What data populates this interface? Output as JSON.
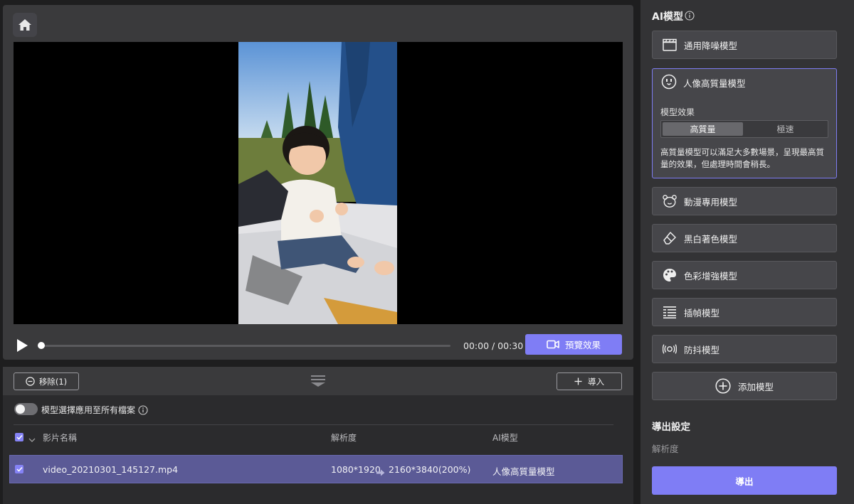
{
  "preview": {
    "time": "00:00 / 00:30",
    "preview_label": "預覽效果",
    "progress": 0
  },
  "files": {
    "remove_label": "移除(1)",
    "import_label": "導入",
    "apply_all_label": "模型選擇應用至所有檔案",
    "apply_all_on": false,
    "columns": {
      "name": "影片名稱",
      "resolution": "解析度",
      "model": "AI模型"
    },
    "rows": [
      {
        "name": "video_20210301_145127.mp4",
        "resolution_from": "1080*1920",
        "resolution_to": "2160*3840(200%)",
        "model": "人像高質量模型",
        "checked": true
      }
    ]
  },
  "models": {
    "title": "AI模型",
    "items": [
      {
        "label": "通用降噪模型",
        "icon": "clapperboard-icon"
      },
      {
        "label": "人像高質量模型",
        "icon": "face-icon",
        "selected": true
      },
      {
        "label": "動漫專用模型",
        "icon": "bear-icon"
      },
      {
        "label": "黑白著色模型",
        "icon": "eraser-icon"
      },
      {
        "label": "色彩增強模型",
        "icon": "palette-icon"
      },
      {
        "label": "插幀模型",
        "icon": "frames-icon"
      },
      {
        "label": "防抖模型",
        "icon": "stabilize-icon"
      }
    ],
    "effect_label": "模型效果",
    "effect_options": [
      "高質量",
      "極速"
    ],
    "effect_selected": "高質量",
    "description": "高質量模型可以滿足大多數場景，呈現最高質量的效果，但處理時間會稍長。",
    "add_label": "添加模型"
  },
  "export": {
    "title": "導出設定",
    "resolution_label": "解析度",
    "export_label": "導出"
  },
  "colors": {
    "accent": "#7f7df5",
    "selected_row": "#5b5a96",
    "panel": "#3a3a3c"
  }
}
